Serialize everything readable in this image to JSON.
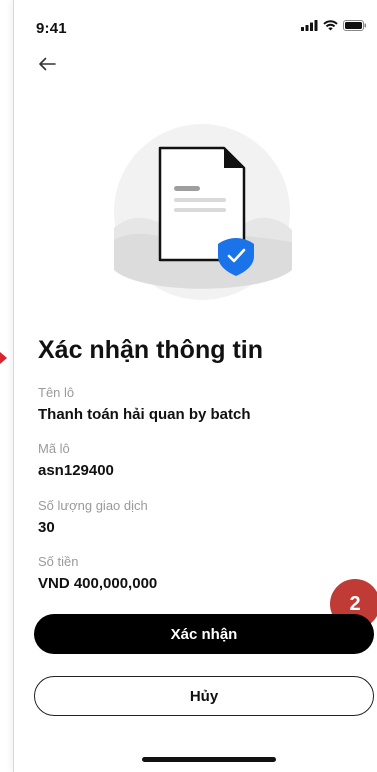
{
  "status_bar": {
    "time": "9:41",
    "icons": [
      "signal-icon",
      "wifi-icon",
      "battery-icon"
    ]
  },
  "navigation": {
    "back_icon": "arrow-left-icon"
  },
  "illustration": {
    "icon": "document-verified-icon"
  },
  "title": "Xác nhận thông tin",
  "fields": [
    {
      "label": "Tên lô",
      "value": "Thanh toán hải quan by batch"
    },
    {
      "label": "Mã lô",
      "value": "asn129400"
    },
    {
      "label": "Số lượng giao dịch",
      "value": "30"
    },
    {
      "label": "Số tiền",
      "value": "VND 400,000,000"
    }
  ],
  "step_badge": "2",
  "actions": {
    "confirm_label": "Xác nhận",
    "cancel_label": "Hủy"
  },
  "colors": {
    "primary_button": "#000000",
    "badge": "#c03a36",
    "shield": "#1a73e8",
    "marker": "#d9232d"
  }
}
